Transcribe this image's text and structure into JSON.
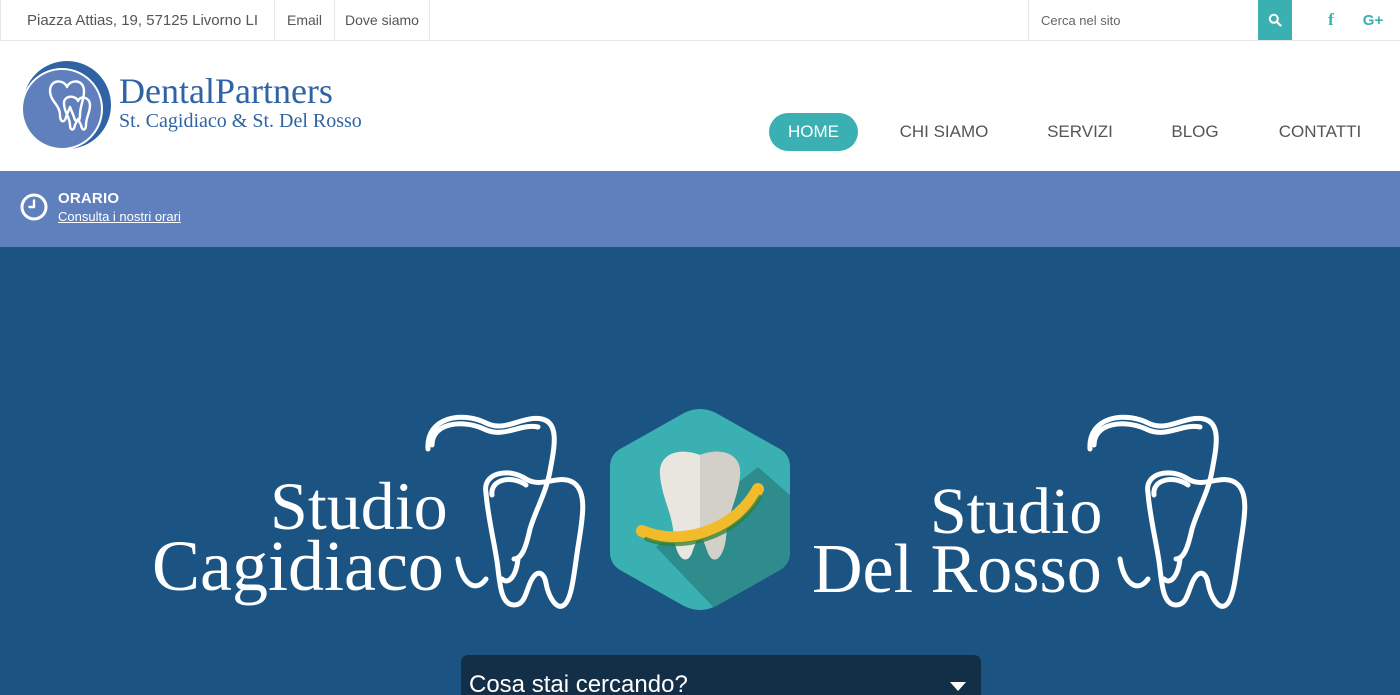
{
  "topbar": {
    "address": "Piazza Attias, 19, 57125 Livorno LI",
    "email_label": "Email",
    "location_label": "Dove siamo",
    "search_placeholder": "Cerca nel sito",
    "facebook_glyph": "f",
    "googleplus_glyph": "G+",
    "icons": [
      "search-icon",
      "facebook-icon",
      "google-plus-icon"
    ]
  },
  "logo": {
    "title": "DentalPartners",
    "subtitle": "St. Cagidiaco & St. Del Rosso"
  },
  "nav": {
    "items": [
      {
        "label": "HOME",
        "active": true
      },
      {
        "label": "CHI SIAMO",
        "active": false
      },
      {
        "label": "SERVIZI",
        "active": false
      },
      {
        "label": "BLOG",
        "active": false
      },
      {
        "label": "CONTATTI",
        "active": false
      }
    ]
  },
  "hours": {
    "title": "ORARIO",
    "link": "Consulta i nostri orari",
    "icon": "clock-icon"
  },
  "hero": {
    "left_logo": {
      "line1": "Studio",
      "line2": "Cagidiaco"
    },
    "right_logo": {
      "line1": "Studio",
      "line2": "Del Rosso"
    },
    "select_label": "Cosa stai cercando?",
    "icons": [
      "tooth-outline-icon",
      "tooth-hexagon-icon",
      "chevron-down-icon"
    ]
  },
  "colors": {
    "accent": "#3ab0b2",
    "brand_blue": "#2f63a3",
    "hours_bg": "#5f80bd",
    "hero_bg": "#1b5482",
    "select_bg": "#132f47"
  }
}
